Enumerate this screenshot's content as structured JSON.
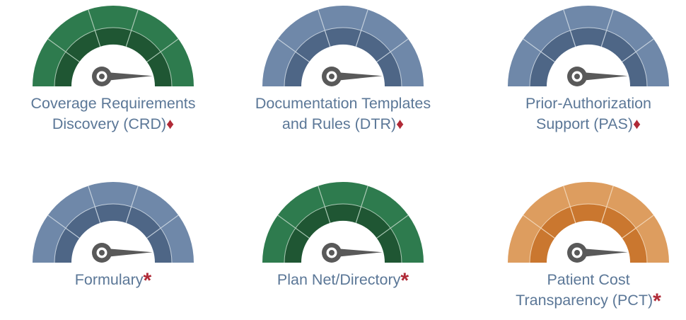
{
  "colors": {
    "green": {
      "outer": "#2e7b4e",
      "inner": "#1f5633",
      "divider": "#aac9b4"
    },
    "blue": {
      "outer": "#6f88a9",
      "inner": "#4e6686",
      "divider": "#c3cfdc"
    },
    "orange": {
      "outer": "#dd9d5f",
      "inner": "#ca772f",
      "divider": "#f1d3b2"
    },
    "hub": "#595959",
    "needle": "#595959",
    "label_text": "#5b7797",
    "marker": "#b02a37"
  },
  "gauges": [
    {
      "id": "crd",
      "label_lines": [
        "Coverage Requirements",
        "Discovery (CRD)"
      ],
      "marker": "diamond",
      "marker_glyph": "♦",
      "color": "green",
      "needle_level": 0.03
    },
    {
      "id": "dtr",
      "label_lines": [
        "Documentation Templates",
        "and Rules (DTR)"
      ],
      "marker": "diamond",
      "marker_glyph": "♦",
      "color": "blue",
      "needle_level": 0.03
    },
    {
      "id": "pas",
      "label_lines": [
        "Prior-Authorization",
        "Support (PAS)"
      ],
      "marker": "diamond",
      "marker_glyph": "♦",
      "color": "blue",
      "needle_level": 0.03
    },
    {
      "id": "formulary",
      "label_lines": [
        "Formulary"
      ],
      "marker": "asterisk",
      "marker_glyph": "*",
      "color": "blue",
      "needle_level": 0.03
    },
    {
      "id": "plan-net",
      "label_lines": [
        "Plan Net/Directory"
      ],
      "marker": "asterisk",
      "marker_glyph": "*",
      "color": "green",
      "needle_level": 0.03
    },
    {
      "id": "pct",
      "label_lines": [
        "Patient Cost",
        "Transparency (PCT)"
      ],
      "marker": "asterisk",
      "marker_glyph": "*",
      "color": "orange",
      "needle_level": 0.03
    }
  ]
}
